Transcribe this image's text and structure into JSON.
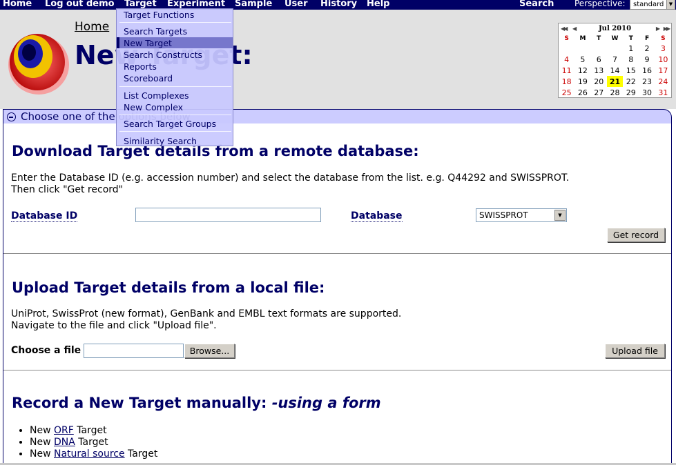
{
  "nav": {
    "items": [
      "Home",
      "Log out demo",
      "Target",
      "Experiment",
      "Sample",
      "User",
      "History",
      "Help"
    ],
    "search": "Search",
    "perspective_label": "Perspective:",
    "perspective_value": "standard"
  },
  "header": {
    "breadcrumb": "Home",
    "title": "New Target:"
  },
  "calendar": {
    "month_label": "Jul 2010",
    "weekdays": [
      "S",
      "M",
      "T",
      "W",
      "T",
      "F",
      "S"
    ],
    "weeks": [
      [
        "",
        "",
        "",
        "",
        "1",
        "2",
        "3"
      ],
      [
        "4",
        "5",
        "6",
        "7",
        "8",
        "9",
        "10"
      ],
      [
        "11",
        "12",
        "13",
        "14",
        "15",
        "16",
        "17"
      ],
      [
        "18",
        "19",
        "20",
        "21",
        "22",
        "23",
        "24"
      ],
      [
        "25",
        "26",
        "27",
        "28",
        "29",
        "30",
        "31"
      ]
    ],
    "today": "21"
  },
  "dropdown": {
    "items": [
      "Target Functions",
      "Search Targets",
      "New Target",
      "Search Constructs",
      "Reports",
      "Scoreboard",
      "List Complexes",
      "New Complex",
      "Search Target Groups",
      "Similarity Search"
    ],
    "selected": "New Target"
  },
  "panel": {
    "tab_label": "Choose one of the options below",
    "remote": {
      "title": "Download Target details from a remote database:",
      "desc_line1": "Enter the Database ID (e.g. accession number) and select the database from the list. e.g. Q44292 and SWISSPROT.",
      "desc_line2": "Then click \"Get record\"",
      "db_id_label": "Database ID",
      "db_id_value": "",
      "database_label": "Database",
      "database_value": "SWISSPROT",
      "get_record_button": "Get record"
    },
    "upload": {
      "title": "Upload Target details from a local file:",
      "desc_line1": "UniProt, SwissProt (new format), GenBank and EMBL text formats are supported.",
      "desc_line2": "Navigate to the file and click \"Upload file\".",
      "choose_label": "Choose a file",
      "file_value": "",
      "browse_button": "Browse...",
      "upload_button": "Upload file"
    },
    "manual": {
      "title_main": "Record a New Target manually: ",
      "title_em": "-using a form",
      "items": [
        {
          "prefix": "New ",
          "link": "ORF",
          "suffix": " Target"
        },
        {
          "prefix": "New ",
          "link": "DNA",
          "suffix": " Target"
        },
        {
          "prefix": "New ",
          "link": "Natural source",
          "suffix": " Target"
        }
      ]
    }
  }
}
